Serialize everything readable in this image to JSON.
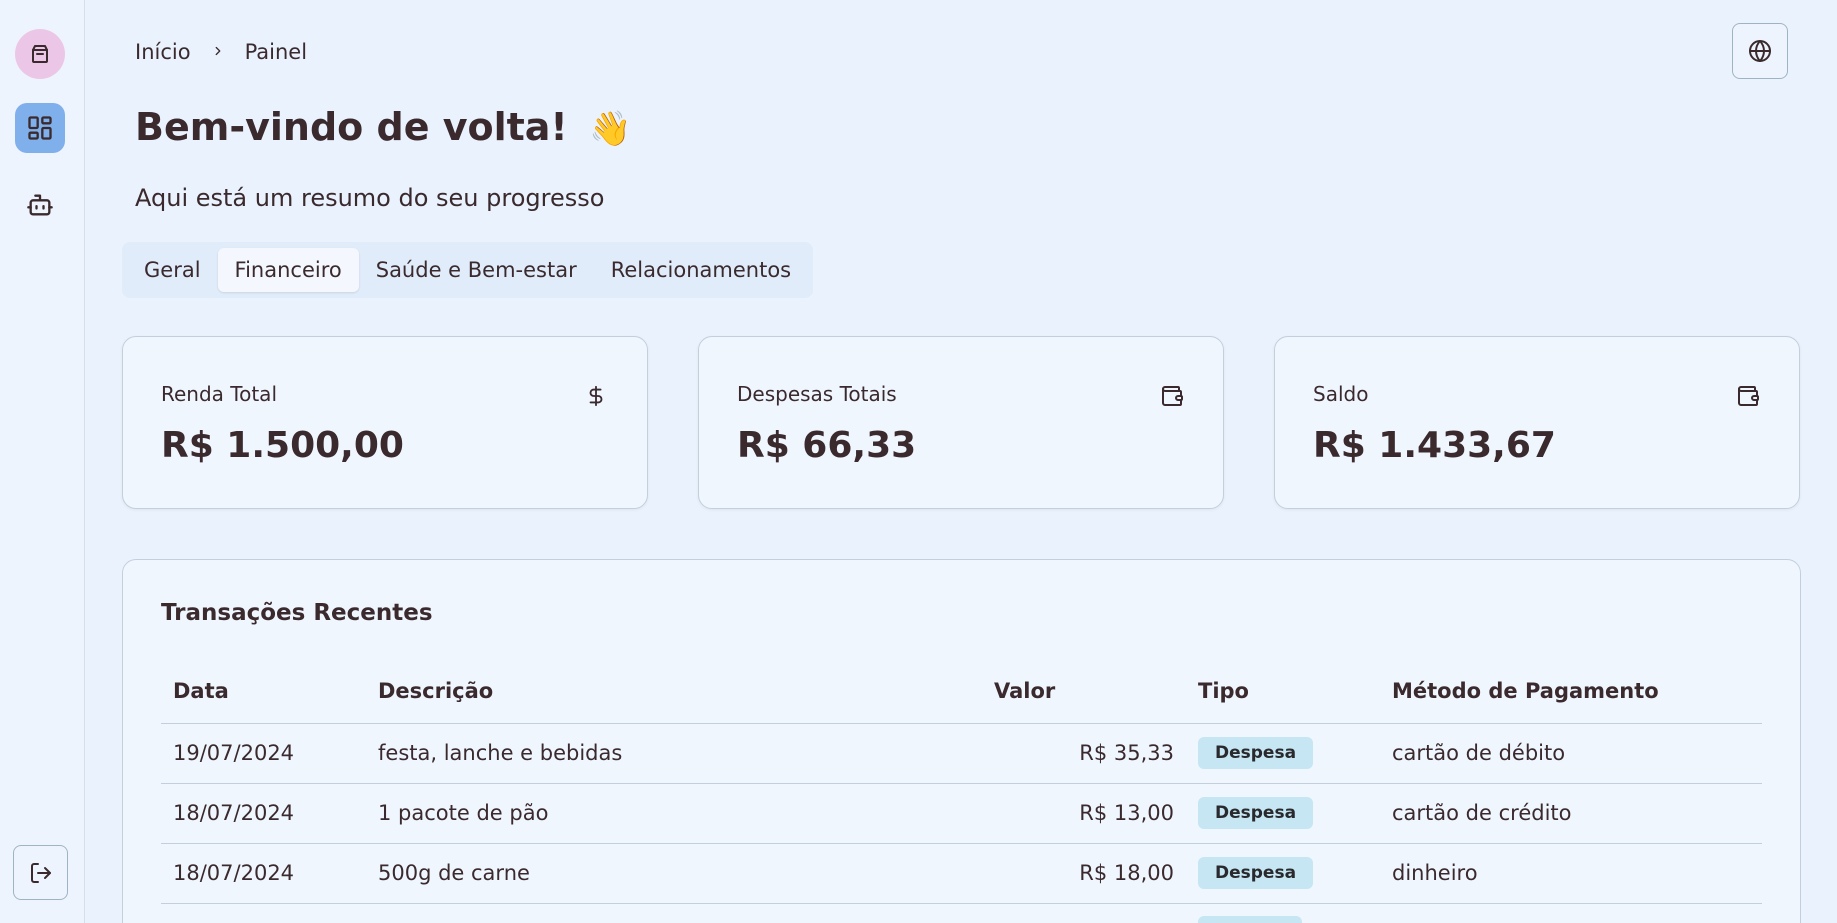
{
  "breadcrumb": {
    "home": "Início",
    "current": "Painel"
  },
  "header": {
    "title": "Bem-vindo de volta!",
    "emoji": "👋",
    "subtitle": "Aqui está um resumo do seu progresso"
  },
  "tabs": [
    {
      "label": "Geral",
      "active": false
    },
    {
      "label": "Financeiro",
      "active": true
    },
    {
      "label": "Saúde e Bem-estar",
      "active": false
    },
    {
      "label": "Relacionamentos",
      "active": false
    }
  ],
  "cards": [
    {
      "label": "Renda Total",
      "value": "R$ 1.500,00",
      "icon": "dollar-icon"
    },
    {
      "label": "Despesas Totais",
      "value": "R$ 66,33",
      "icon": "wallet-icon"
    },
    {
      "label": "Saldo",
      "value": "R$ 1.433,67",
      "icon": "wallet-icon"
    }
  ],
  "transactions": {
    "title": "Transações Recentes",
    "columns": [
      "Data",
      "Descrição",
      "Valor",
      "Tipo",
      "Método de Pagamento"
    ],
    "rows": [
      {
        "date": "19/07/2024",
        "description": "festa, lanche e bebidas",
        "amount": "R$ 35,33",
        "type": "Despesa",
        "method": "cartão de débito"
      },
      {
        "date": "18/07/2024",
        "description": "1 pacote de pão",
        "amount": "R$ 13,00",
        "type": "Despesa",
        "method": "cartão de crédito"
      },
      {
        "date": "18/07/2024",
        "description": "500g de carne",
        "amount": "R$ 18,00",
        "type": "Despesa",
        "method": "dinheiro"
      }
    ]
  },
  "colors": {
    "background": "#eaf2fd",
    "accent": "#7fb0ec",
    "logo_bg": "#ecc6e6",
    "badge_bg": "#c5e6f2",
    "text": "#3a2a2e"
  }
}
